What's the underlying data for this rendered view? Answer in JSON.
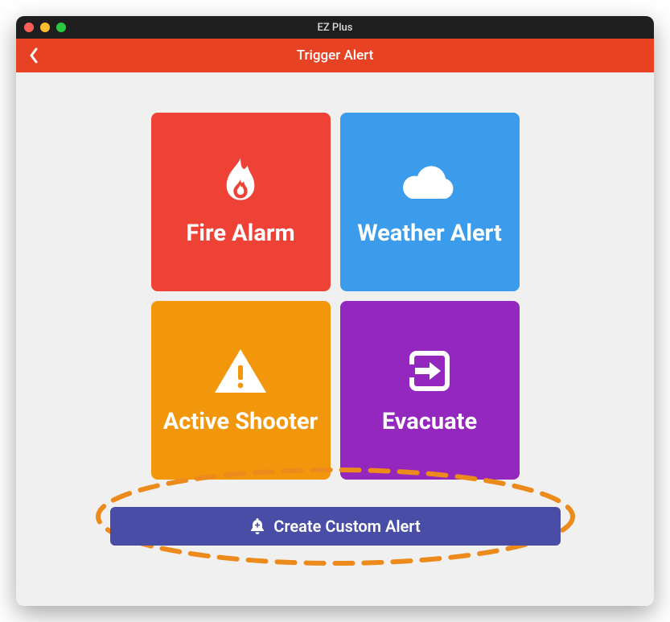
{
  "window": {
    "title": "EZ Plus"
  },
  "navbar": {
    "title": "Trigger Alert"
  },
  "tiles": {
    "fire": {
      "label": "Fire Alarm"
    },
    "weather": {
      "label": "Weather Alert"
    },
    "shooter": {
      "label": "Active Shooter"
    },
    "evacuate": {
      "label": "Evacuate"
    }
  },
  "custom": {
    "label": "Create Custom Alert"
  },
  "colors": {
    "navbar": "#e84224",
    "fire": "#ef4237",
    "weather": "#3b9cec",
    "shooter": "#f2960c",
    "evacuate": "#9427bd",
    "custom": "#4a4da6",
    "highlight": "#ec8a1c"
  }
}
